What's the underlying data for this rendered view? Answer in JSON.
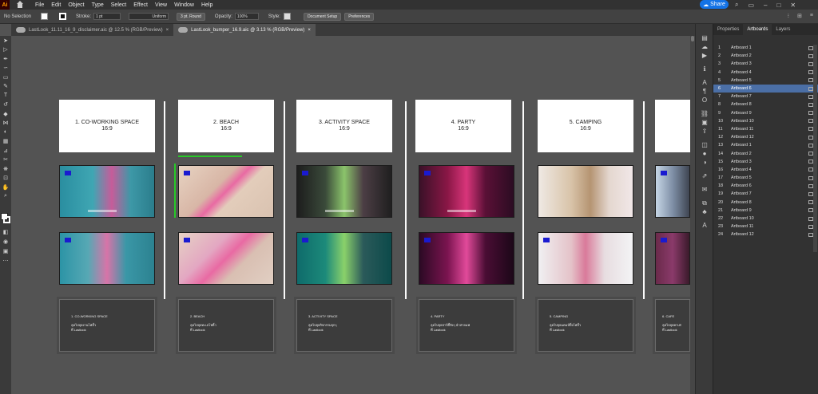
{
  "app": {
    "logo": "Ai"
  },
  "menu": [
    "File",
    "Edit",
    "Object",
    "Type",
    "Select",
    "Effect",
    "View",
    "Window",
    "Help"
  ],
  "share_label": "Share",
  "control": {
    "selection": "No Selection",
    "stroke_label": "Stroke:",
    "stroke_value": "1 pt",
    "profile": "Uniform",
    "brush": "3 pt. Round",
    "opacity_label": "Opacity:",
    "opacity_value": "100%",
    "style_label": "Style:",
    "doc_setup": "Document Setup",
    "preferences": "Preferences"
  },
  "tabs": [
    {
      "label": "LastLook_11.11_16_9_disclaimer.aic @ 12.5 % (RGB/Preview)"
    },
    {
      "label": "LastLook_bumper_16.9.aic @ 3.13 % (RGB/Preview)"
    }
  ],
  "panel": {
    "tabs": [
      "Properties",
      "Artboards",
      "Layers"
    ],
    "artboards": [
      {
        "num": "1",
        "name": "Artboard 1"
      },
      {
        "num": "2",
        "name": "Artboard 2"
      },
      {
        "num": "3",
        "name": "Artboard 3"
      },
      {
        "num": "4",
        "name": "Artboard 4"
      },
      {
        "num": "5",
        "name": "Artboard 5"
      },
      {
        "num": "6",
        "name": "Artboard 6"
      },
      {
        "num": "7",
        "name": "Artboard 7"
      },
      {
        "num": "8",
        "name": "Artboard 8"
      },
      {
        "num": "9",
        "name": "Artboard 9"
      },
      {
        "num": "10",
        "name": "Artboard 10"
      },
      {
        "num": "11",
        "name": "Artboard 11"
      },
      {
        "num": "12",
        "name": "Artboard 12"
      },
      {
        "num": "13",
        "name": "Artboard 1"
      },
      {
        "num": "14",
        "name": "Artboard 2"
      },
      {
        "num": "15",
        "name": "Artboard 3"
      },
      {
        "num": "16",
        "name": "Artboard 4"
      },
      {
        "num": "17",
        "name": "Artboard 5"
      },
      {
        "num": "18",
        "name": "Artboard 6"
      },
      {
        "num": "19",
        "name": "Artboard 7"
      },
      {
        "num": "20",
        "name": "Artboard 8"
      },
      {
        "num": "21",
        "name": "Artboard 9"
      },
      {
        "num": "22",
        "name": "Artboard 10"
      },
      {
        "num": "23",
        "name": "Artboard 11"
      },
      {
        "num": "24",
        "name": "Artboard 12"
      }
    ]
  },
  "artboards": {
    "titles": [
      {
        "title": "1. CO-WORKING SPACE",
        "ratio": "16:9"
      },
      {
        "title": "2. BEACH",
        "ratio": "16:9"
      },
      {
        "title": "3. ACTIVITY SPACE",
        "ratio": "16:9"
      },
      {
        "title": "4. PARTY",
        "ratio": "16:9"
      },
      {
        "title": "5. CAMPING",
        "ratio": "16:9"
      }
    ],
    "dark_cards": [
      {
        "t1": "1. CO-WORKING SPACE",
        "t2a": "ลุคไปลุยงานโฟลิ้ว",
        "t2b": "ที่ Lastlook"
      },
      {
        "t1": "2. BEACH",
        "t2a": "ลุคไปลุยทะเลโฟลิ้ว",
        "t2b": "ที่ Lastlook"
      },
      {
        "t1": "3. ACTIVITY SPACE",
        "t2a": "ลุคไปลุยกิจกรรมจุกๆ",
        "t2b": "ที่ Lastlook"
      },
      {
        "t1": "4. PARTY",
        "t2a": "ลุคไปลุยปาร์ตี้ปังๆ นำสายแฟ",
        "t2b": "ที่ Lastlook"
      },
      {
        "t1": "5. CAMPING",
        "t2a": "ลุคไปลุยแคมป์ปิ้งโฟลิ้ว",
        "t2b": "ที่ Lastlook"
      },
      {
        "t1": "6. CAFE",
        "t2a": "ลุคไปลุยคาเฟ่",
        "t2b": "ที่ Lastlook"
      }
    ]
  }
}
